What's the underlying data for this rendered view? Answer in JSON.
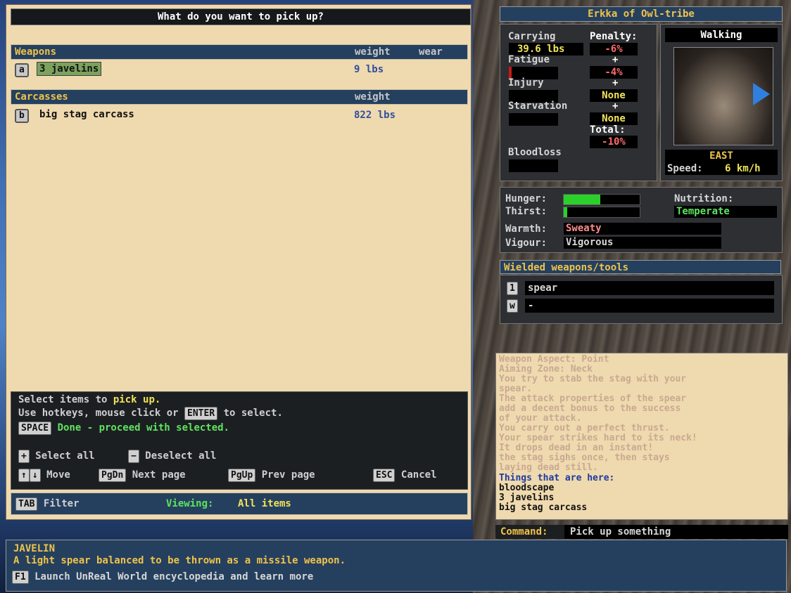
{
  "pickup": {
    "title": "What do you want to pick up?",
    "categories": [
      {
        "name": "Weapons",
        "col_weight": "weight",
        "col_wear": "wear",
        "items": [
          {
            "key": "a",
            "name": "3 javelins",
            "weight": "9 lbs",
            "selected": true
          }
        ]
      },
      {
        "name": "Carcasses",
        "col_weight": "weight",
        "items": [
          {
            "key": "b",
            "name": "big stag carcass",
            "weight": "822 lbs",
            "selected": false
          }
        ]
      }
    ],
    "help": {
      "line1_pre": "Select items to",
      "line1_hl": "pick up.",
      "line2_pre": "Use hotkeys, mouse click or",
      "enter_key": "ENTER",
      "line2_post": "to select.",
      "space_key": "SPACE",
      "space_text": "Done - proceed with selected.",
      "plus_key": "+",
      "select_all": "Select all",
      "minus_key": "−",
      "deselect_all": "Deselect all",
      "up_key": "↑",
      "down_key": "↓",
      "move": "Move",
      "pgdn_key": "PgDn",
      "next_page": "Next page",
      "pgup_key": "PgUp",
      "prev_page": "Prev page",
      "esc_key": "ESC",
      "cancel": "Cancel"
    },
    "filter": {
      "tab_key": "TAB",
      "label": "Filter",
      "viewing_label": "Viewing:",
      "viewing_value": "All items"
    }
  },
  "character": {
    "name": "Erkka of Owl-tribe",
    "carrying_label": "Carrying",
    "carrying_value": "39.6 lbs",
    "penalty_label": "Penalty:",
    "fatigue_label": "Fatigue",
    "injury_label": "Injury",
    "starvation_label": "Starvation",
    "bloodloss_label": "Bloodloss",
    "penalties": [
      "-6%",
      "-4%",
      "None",
      "None"
    ],
    "plus": "+",
    "total_label": "Total:",
    "total_value": "-10%",
    "movement": "Walking",
    "direction": "EAST",
    "speed_label": "Speed:",
    "speed_value": "6 km/h",
    "fatigue_level": 0.05
  },
  "needs": {
    "hunger_label": "Hunger:",
    "hunger_level": 0.48,
    "thirst_label": "Thirst:",
    "thirst_level": 0.05,
    "nutrition_label": "Nutrition:",
    "nutrition_value": "Temperate",
    "warmth_label": "Warmth:",
    "warmth_value": "Sweaty",
    "vigour_label": "Vigour:",
    "vigour_value": "Vigorous"
  },
  "wielded": {
    "title": "Wielded weapons/tools",
    "slots": [
      {
        "key": "1",
        "value": "spear"
      },
      {
        "key": "w",
        "value": "-"
      }
    ]
  },
  "messages": {
    "faded": [
      "Weapon Aspect: Point",
      "Aiming Zone: Neck",
      "You try to stab the stag with your",
      "spear.",
      "The attack properties of the spear",
      "add a decent bonus to the success",
      "of your attack.",
      "You carry out a perfect thrust.",
      "Your spear strikes hard to its neck!",
      "It drops dead in an instant!",
      "the stag sighs once, then stays",
      "laying dead still."
    ],
    "things_header": "Things that are here:",
    "things": [
      "bloodscape",
      "3 javelins",
      "big stag carcass"
    ]
  },
  "command": {
    "label": "Command:",
    "value": "Pick up something"
  },
  "info": {
    "title": "JAVELIN",
    "description": "A light spear balanced to be thrown as a missile weapon.",
    "f1_key": "F1",
    "f1_text": "Launch UnReal World encyclopedia and learn more"
  },
  "colors": {
    "accent": "#f0c34a",
    "panel_bg": "#efd9ae",
    "header_bg": "#25405f",
    "selected": "#7ba35e",
    "weight": "#2f4fa0",
    "penalty": "#ff6a6a",
    "bar": "#2bd02b"
  }
}
